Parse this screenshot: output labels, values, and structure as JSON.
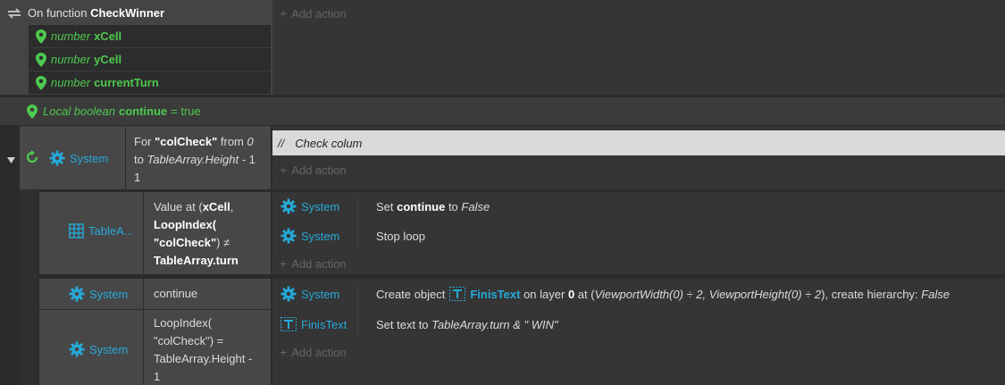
{
  "function_block": {
    "prefix": "On function",
    "name": "CheckWinner",
    "params": [
      {
        "type": "number",
        "name": "xCell"
      },
      {
        "type": "number",
        "name": "yCell"
      },
      {
        "type": "number",
        "name": "currentTurn"
      }
    ],
    "add_action": "Add action"
  },
  "local_var": {
    "keyword": "Local boolean",
    "name": "continue",
    "eq": "= true"
  },
  "for_loop": {
    "object": "System",
    "prefix": "For",
    "var": "\"colCheck\"",
    "from": "from",
    "start": "0",
    "to": "to",
    "end_expr": "TableArray.Height",
    "end_tail": "- 1",
    "comment_slashes": "//",
    "comment": "Check colum",
    "add_action": "Add action"
  },
  "sub_event_1": {
    "cond_object": "TableA...",
    "cond_l1_a": "Value at (",
    "cond_l1_b": "xCell",
    "cond_l1_c": ",",
    "cond_l2": "LoopIndex(",
    "cond_l3_a": "\"colCheck\"",
    "cond_l3_b": ") ≠",
    "cond_l4": "TableArray.turn",
    "actions": [
      {
        "object": "System",
        "pre": "Set",
        "bold": "continue",
        "mid": "to",
        "ital": "False"
      },
      {
        "object": "System",
        "text": "Stop loop"
      }
    ],
    "add_action": "Add action"
  },
  "sub_event_2": {
    "cond1_object": "System",
    "cond1_text": "continue",
    "cond2_object": "System",
    "cond2_lines": [
      "LoopIndex(",
      "\"colCheck\") =",
      "TableArray.Height -",
      "1"
    ],
    "actions": [
      {
        "object": "System",
        "pre": "Create object",
        "target": "FinisText",
        "mid": "on layer",
        "layer": "0",
        "at": "at (",
        "expr": "ViewportWidth(0) ÷ 2, ViewportHeight(0) ÷ 2",
        "tail": "), create hierarchy:",
        "hier": "False"
      },
      {
        "object": "FinisText",
        "pre": "Set text to",
        "expr": "TableArray.turn & \" WIN\""
      }
    ],
    "add_action": "Add action"
  },
  "colors": {
    "accent_blue": "#26a9d9",
    "param_green": "#4ec94e",
    "comment_bg": "#d9d9d9"
  },
  "icons": {
    "function": "refresh-arrows-icon",
    "param": "map-pin-icon",
    "loop": "loop-icon",
    "system": "gear-icon",
    "array": "grid-icon",
    "text": "text-object-icon",
    "collapse": "triangle-down-icon"
  }
}
